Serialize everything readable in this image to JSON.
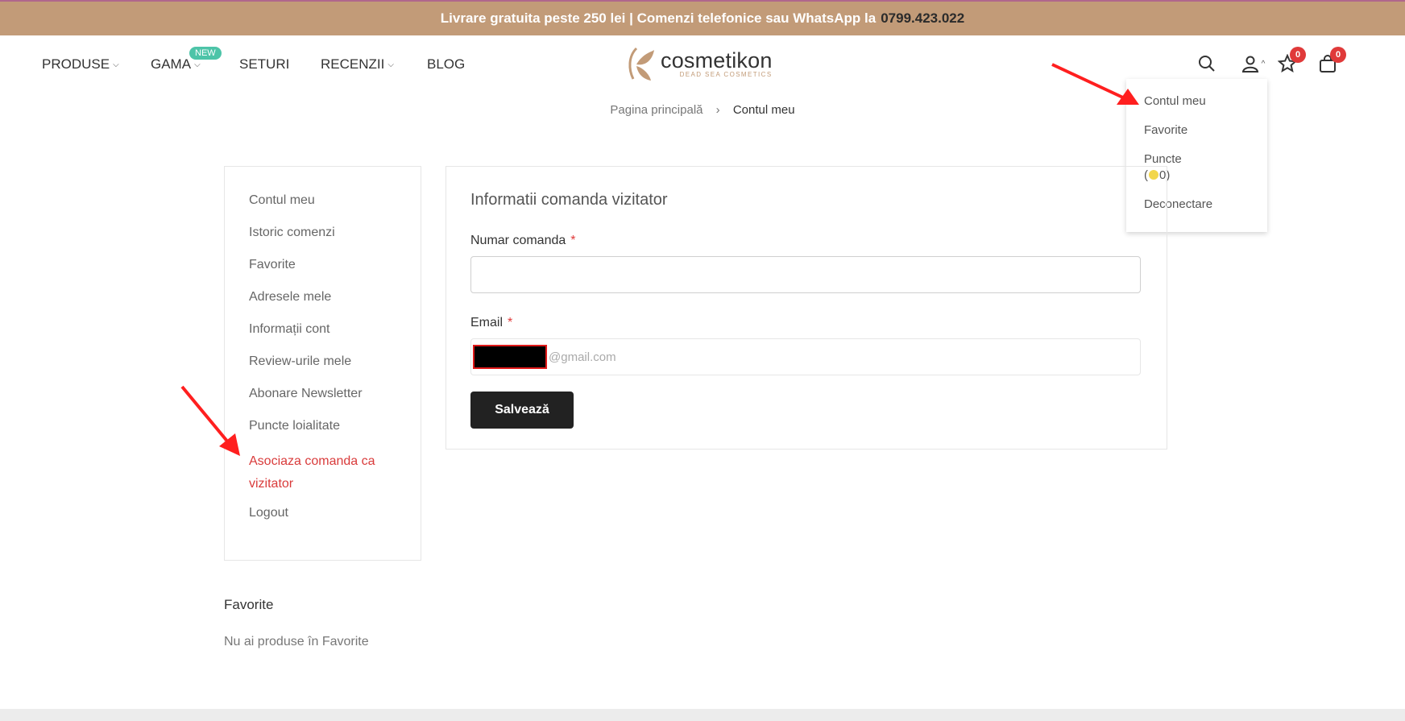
{
  "topbar": {
    "text": "Livrare gratuita peste 250 lei | Comenzi telefonice sau WhatsApp la",
    "phone": "0799.423.022"
  },
  "nav": {
    "items": [
      {
        "label": "PRODUSE",
        "dropdown": true
      },
      {
        "label": "GAMA",
        "dropdown": true,
        "badge": "New"
      },
      {
        "label": "SETURI",
        "dropdown": false
      },
      {
        "label": "RECENZII",
        "dropdown": true
      },
      {
        "label": "BLOG",
        "dropdown": false
      }
    ]
  },
  "logo": {
    "name": "cosmetikon",
    "tagline": "DEAD SEA COSMETICS",
    "color": "#c29b78"
  },
  "header_icons": {
    "search": "search-icon",
    "account": "user-icon",
    "wishlist": "star-icon",
    "wishlist_count": "0",
    "cart": "bag-icon",
    "cart_count": "0"
  },
  "account_dropdown": {
    "items": [
      "Contul meu",
      "Favorite",
      "Puncte",
      "Deconectare"
    ],
    "points_open": "(",
    "points_value": "0)"
  },
  "breadcrumb": {
    "home": "Pagina principală",
    "separator": "›",
    "current": "Contul meu"
  },
  "sidebar": {
    "items": [
      {
        "label": "Contul meu",
        "active": false
      },
      {
        "label": "Istoric comenzi",
        "active": false
      },
      {
        "label": "Favorite",
        "active": false
      },
      {
        "label": "Adresele mele",
        "active": false
      },
      {
        "label": "Informații cont",
        "active": false
      },
      {
        "label": "Review-urile mele",
        "active": false
      },
      {
        "label": "Abonare Newsletter",
        "active": false
      },
      {
        "label": "Puncte loialitate",
        "active": false
      },
      {
        "label": "Asociaza comanda ca vizitator",
        "active": true
      },
      {
        "label": "Logout",
        "active": false
      }
    ]
  },
  "form": {
    "title": "Informatii comanda vizitator",
    "order_label": "Numar comanda",
    "order_value": "",
    "email_label": "Email",
    "email_value_suffix": "@gmail.com",
    "required_mark": "*",
    "save_label": "Salvează"
  },
  "favorites": {
    "title": "Favorite",
    "empty_text": "Nu ai produse în Favorite"
  },
  "colors": {
    "topbar": "#c29b78",
    "active": "#d93b3b",
    "badge_new": "#4dc4a8",
    "count_badge": "#e03a3a",
    "annotation": "#ff1f1f"
  }
}
